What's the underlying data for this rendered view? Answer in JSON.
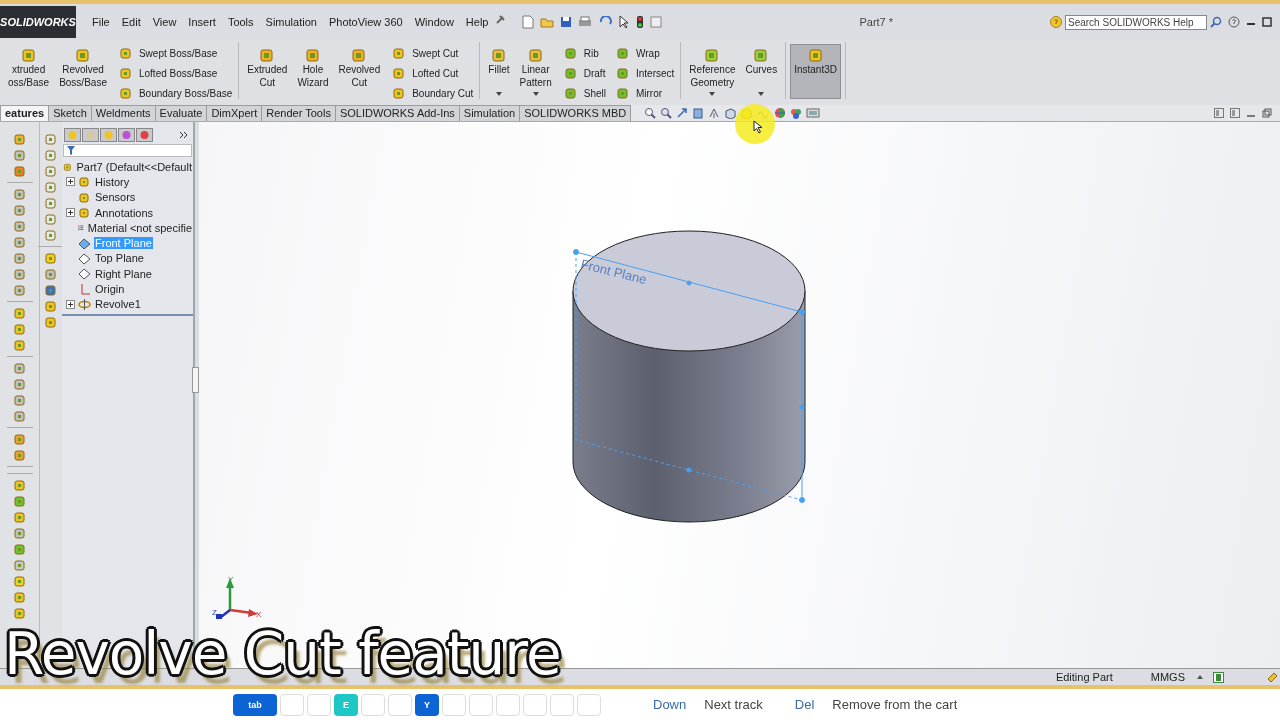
{
  "app": {
    "logo": "SOLIDWORKS",
    "menu": [
      "File",
      "Edit",
      "View",
      "Insert",
      "Tools",
      "Simulation",
      "PhotoView 360",
      "Window",
      "Help"
    ],
    "title": "Part7 *",
    "search": {
      "placeholder": "Search SOLIDWORKS Help"
    }
  },
  "ribbon": {
    "groups": [
      {
        "items": [
          {
            "kind": "large",
            "lines": [
              "xtruded",
              "oss/Base"
            ],
            "on": false,
            "dropdown": false
          },
          {
            "kind": "large",
            "lines": [
              "Revolved",
              "Boss/Base"
            ],
            "on": false,
            "dropdown": false
          },
          {
            "kind": "column",
            "items": [
              "Swept Boss/Base",
              "Lofted Boss/Base",
              "Boundary Boss/Base"
            ]
          }
        ]
      },
      {
        "items": [
          {
            "kind": "large",
            "lines": [
              "Extruded",
              "Cut"
            ],
            "on": false,
            "dropdown": false
          },
          {
            "kind": "large",
            "lines": [
              "Hole",
              "Wizard"
            ],
            "on": false,
            "dropdown": false
          },
          {
            "kind": "large",
            "lines": [
              "Revolved",
              "Cut"
            ],
            "on": false,
            "dropdown": false
          },
          {
            "kind": "column",
            "items": [
              "Swept Cut",
              "Lofted Cut",
              "Boundary Cut"
            ]
          }
        ]
      },
      {
        "items": [
          {
            "kind": "large",
            "lines": [
              "Fillet"
            ],
            "on": false,
            "dropdown": true
          },
          {
            "kind": "large",
            "lines": [
              "Linear",
              "Pattern"
            ],
            "on": false,
            "dropdown": true
          },
          {
            "kind": "column",
            "items": [
              "Rib",
              "Draft",
              "Shell"
            ]
          },
          {
            "kind": "column",
            "items": [
              "Wrap",
              "Intersect",
              "Mirror"
            ]
          }
        ]
      },
      {
        "items": [
          {
            "kind": "large",
            "lines": [
              "Reference",
              "Geometry"
            ],
            "on": false,
            "dropdown": true
          },
          {
            "kind": "large",
            "lines": [
              "Curves"
            ],
            "on": false,
            "dropdown": true
          }
        ]
      },
      {
        "items": [
          {
            "kind": "large",
            "lines": [
              "Instant3D"
            ],
            "on": true,
            "dropdown": false
          }
        ]
      }
    ]
  },
  "tabs": [
    {
      "label": "eatures",
      "selected": true
    },
    {
      "label": "Sketch",
      "selected": false
    },
    {
      "label": "Weldments",
      "selected": false
    },
    {
      "label": "Evaluate",
      "selected": false
    },
    {
      "label": "DimXpert",
      "selected": false
    },
    {
      "label": "Render Tools",
      "selected": false
    },
    {
      "label": "SOLIDWORKS Add-Ins",
      "selected": false
    },
    {
      "label": "Simulation",
      "selected": false
    },
    {
      "label": "SOLIDWORKS MBD",
      "selected": false
    }
  ],
  "tree": {
    "root": "Part7  (Default<<Default",
    "items": [
      {
        "label": "History",
        "expandable": true,
        "selected": false
      },
      {
        "label": "Sensors",
        "expandable": false,
        "selected": false
      },
      {
        "label": "Annotations",
        "expandable": true,
        "selected": false
      },
      {
        "label": "Material <not specifie",
        "expandable": false,
        "selected": false
      },
      {
        "label": "Front Plane",
        "expandable": false,
        "selected": true
      },
      {
        "label": "Top Plane",
        "expandable": false,
        "selected": false
      },
      {
        "label": "Right Plane",
        "expandable": false,
        "selected": false
      },
      {
        "label": "Origin",
        "expandable": false,
        "selected": false
      },
      {
        "label": "Revolve1",
        "expandable": true,
        "selected": false
      }
    ]
  },
  "viewport": {
    "plane_label": "Front Plane",
    "axes": [
      "X",
      "Y",
      "Z"
    ]
  },
  "status_bar": {
    "mode": "Editing Part",
    "units": "MMGS"
  },
  "shortcut_bar": {
    "keys": [
      {
        "kind": "lit",
        "label": "tab",
        "color": "#0b63d4"
      },
      {
        "kind": "blank"
      },
      {
        "kind": "blank"
      },
      {
        "kind": "lit",
        "label": "E",
        "color": "#1fc6c6"
      },
      {
        "kind": "blank"
      },
      {
        "kind": "blank"
      },
      {
        "kind": "lit",
        "label": "Y",
        "color": "#0b63d4"
      },
      {
        "kind": "blank"
      },
      {
        "kind": "blank"
      },
      {
        "kind": "blank"
      },
      {
        "kind": "blank"
      },
      {
        "kind": "blank"
      },
      {
        "kind": "blank"
      }
    ],
    "hints": [
      {
        "key": "Down",
        "action": "Next track"
      },
      {
        "key": "Del",
        "action": "Remove from the cart"
      }
    ]
  },
  "caption": "Revolve Cut feature"
}
